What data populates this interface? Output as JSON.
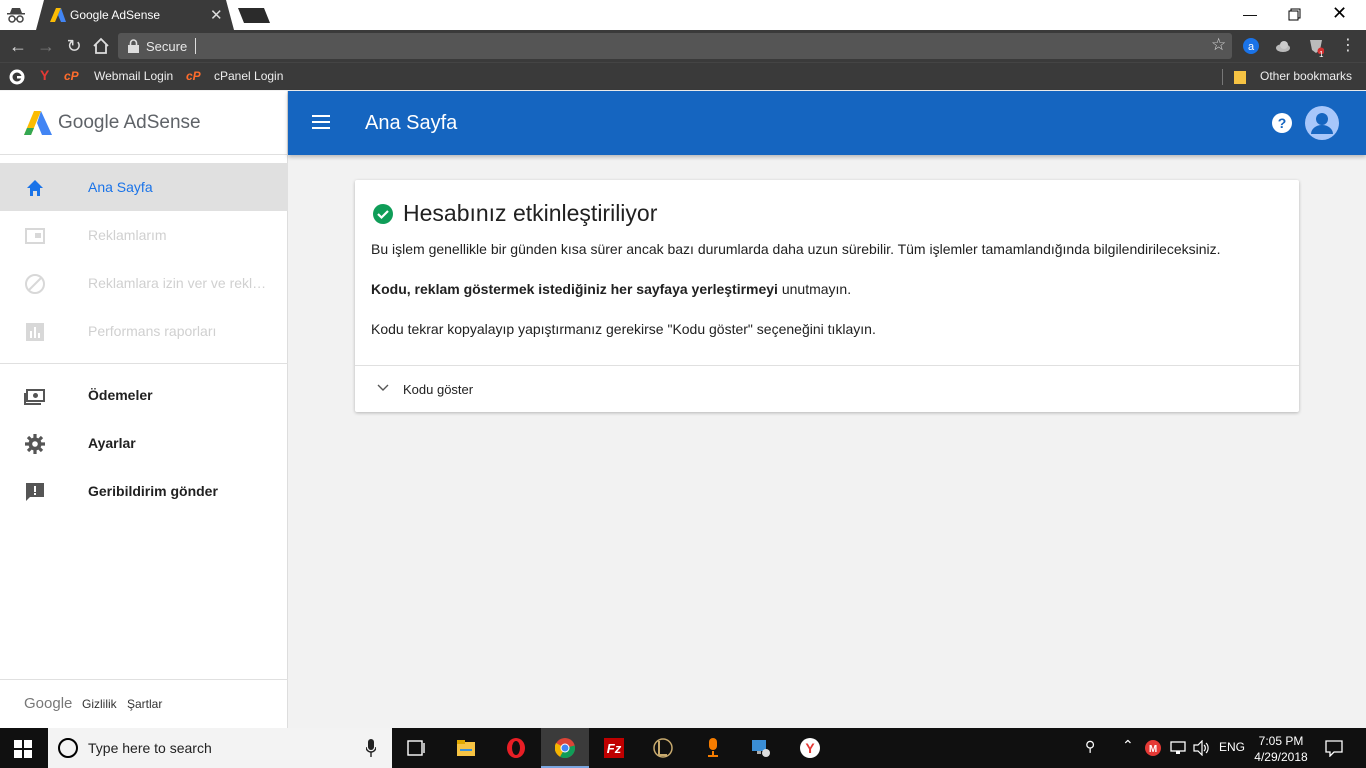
{
  "browser": {
    "tab_title": "Google AdSense",
    "secure_label": "Secure",
    "bookmarks": [
      "Webmail Login",
      "cPanel Login"
    ],
    "other_bookmarks": "Other bookmarks",
    "ext_badge": "1"
  },
  "sidebar": {
    "brand": "Google AdSense",
    "items": [
      {
        "label": "Ana Sayfa",
        "icon": "home-icon",
        "state": "active"
      },
      {
        "label": "Reklamlarım",
        "icon": "ads-icon",
        "state": "disabled"
      },
      {
        "label": "Reklamlara izin ver ve reklamları engelle",
        "icon": "block-icon",
        "state": "disabled"
      },
      {
        "label": "Performans raporları",
        "icon": "chart-icon",
        "state": "disabled"
      },
      {
        "label": "Ödemeler",
        "icon": "payments-icon",
        "state": "normal"
      },
      {
        "label": "Ayarlar",
        "icon": "gear-icon",
        "state": "normal"
      },
      {
        "label": "Geribildirim gönder",
        "icon": "feedback-icon",
        "state": "normal"
      }
    ],
    "footer": {
      "google": "Google",
      "privacy": "Gizlilik",
      "terms": "Şartlar"
    }
  },
  "header": {
    "title": "Ana Sayfa"
  },
  "card": {
    "title": "Hesabınız etkinleştiriliyor",
    "para1": "Bu işlem genellikle bir günden kısa sürer ancak bazı durumlarda daha uzun sürebilir. Tüm işlemler tamamlandığında bilgilendirileceksiniz.",
    "para2_bold": "Kodu, reklam göstermek istediğiniz her sayfaya yerleştirmeyi",
    "para2_rest": " unutmayın.",
    "para3": "Kodu tekrar kopyalayıp yapıştırmanız gerekirse \"Kodu göster\" seçeneğini tıklayın.",
    "show_code": "Kodu göster"
  },
  "taskbar": {
    "search_placeholder": "Type here to search",
    "lang": "ENG",
    "time": "7:05 PM",
    "date": "4/29/2018"
  },
  "colors": {
    "appbar": "#1565c0",
    "active_nav": "#1a73e8",
    "success": "#0f9d58"
  }
}
